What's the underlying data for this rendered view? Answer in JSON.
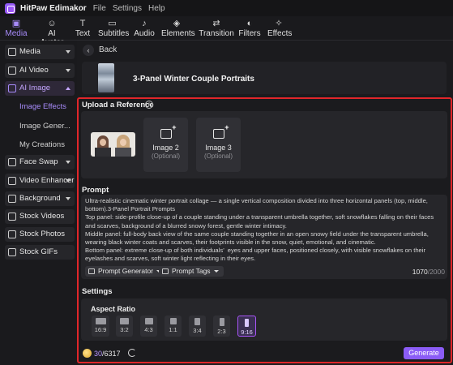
{
  "app": {
    "title": "HitPaw Edimakor",
    "menus": [
      "File",
      "Settings",
      "Help"
    ]
  },
  "toolbar": {
    "items": [
      {
        "label": "Media",
        "icon": "media-icon",
        "active": true
      },
      {
        "label": "AI Avatar",
        "icon": "ai-avatar-icon"
      },
      {
        "label": "Text",
        "icon": "text-icon"
      },
      {
        "label": "Subtitles",
        "icon": "subtitles-icon"
      },
      {
        "label": "Audio",
        "icon": "audio-icon"
      },
      {
        "label": "Elements",
        "icon": "elements-icon"
      },
      {
        "label": "Transition",
        "icon": "transition-icon"
      },
      {
        "label": "Filters",
        "icon": "filters-icon"
      },
      {
        "label": "Effects",
        "icon": "effects-icon"
      }
    ]
  },
  "sidebar": {
    "items": [
      {
        "label": "Media"
      },
      {
        "label": "AI Video"
      },
      {
        "label": "AI Image",
        "active": true
      },
      {
        "label": "Face Swap"
      },
      {
        "label": "Video Enhancer"
      },
      {
        "label": "Background"
      },
      {
        "label": "Stock Videos"
      },
      {
        "label": "Stock Photos"
      },
      {
        "label": "Stock GIFs"
      }
    ],
    "subitems": [
      {
        "label": "Image Effects",
        "active": true
      },
      {
        "label": "Image Gener..."
      },
      {
        "label": "My Creations"
      }
    ]
  },
  "main": {
    "back_label": "Back",
    "template_title": "3-Panel Winter Couple Portraits",
    "upload": {
      "title": "Upload a Reference",
      "cards": [
        {
          "label": "Image 2",
          "sub": "(Optional)"
        },
        {
          "label": "Image 3",
          "sub": "(Optional)"
        }
      ]
    },
    "prompt": {
      "title": "Prompt",
      "text": "Ultra-realistic cinematic winter portrait collage — a single vertical composition divided into three horizontal panels (top, middle, bottom).3-Panel Portrait Prompts\nTop panel: side-profile close-up of a couple standing under a transparent umbrella together, soft snowflakes falling on their faces and scarves, background of a blurred snowy forest, gentle winter intimacy.\nMiddle panel: full-body back view of the same couple standing together in an open snowy field under the transparent umbrella, wearing black winter coats and scarves, their footprints visible in the snow, quiet, emotional, and cinematic.\nBottom panel: extreme close-up of both individuals’  eyes and upper faces, positioned closely, with visible snowflakes on their eyelashes and scarves, soft winter light reflecting in their eyes.",
      "generator_label": "Prompt Generator",
      "tags_label": "Prompt Tags",
      "count": "1070",
      "max": "/2000"
    },
    "settings": {
      "title": "Settings",
      "aspect_title": "Aspect Ratio",
      "ratios": [
        "16:9",
        "3:2",
        "4:3",
        "1:1",
        "3:4",
        "2:3",
        "9:16"
      ],
      "selected": "9:16"
    },
    "footer": {
      "credits_used": "30",
      "credits_total": "/6317",
      "generate_label": "Generate"
    }
  }
}
